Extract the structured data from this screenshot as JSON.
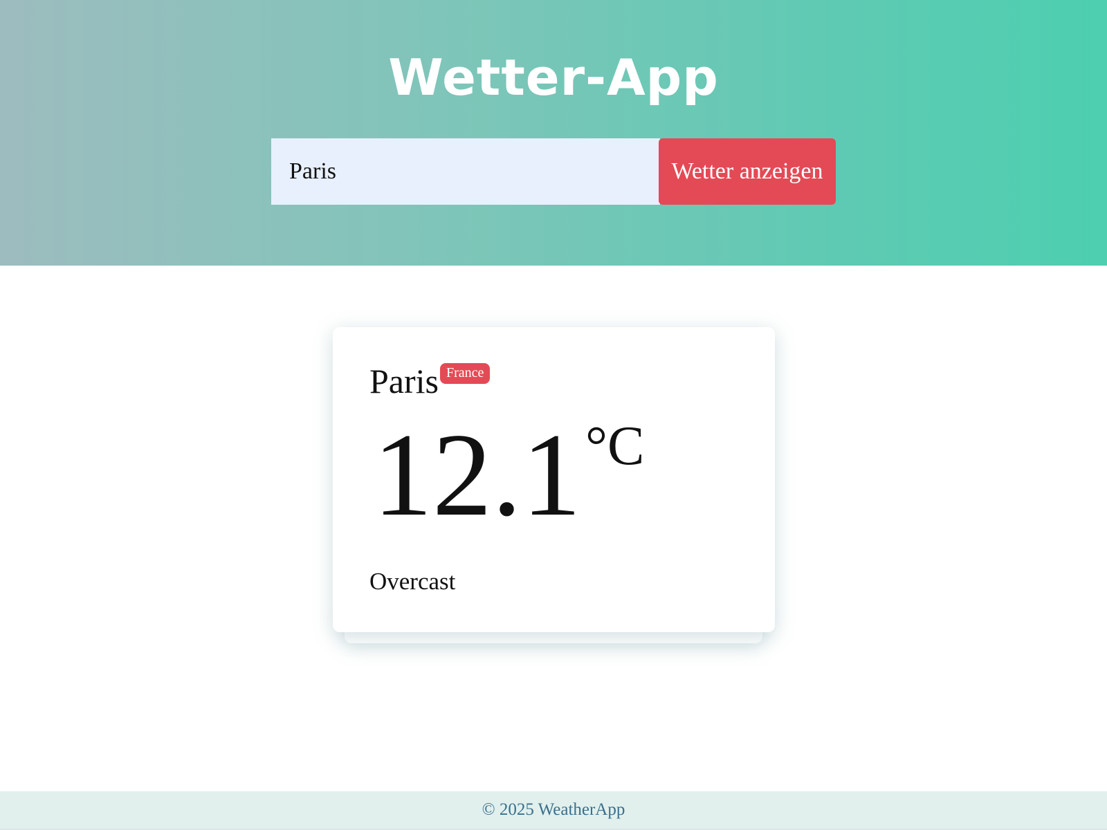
{
  "header": {
    "title": "Wetter-App",
    "search": {
      "value": "Paris",
      "placeholder": ""
    },
    "search_button_label": "Wetter anzeigen"
  },
  "weather_card": {
    "city": "Paris",
    "country": "France",
    "temperature": "12.1",
    "unit": "°C",
    "condition": "Overcast"
  },
  "footer": {
    "text": "© 2025 WeatherApp"
  },
  "colors": {
    "accent": "#e44a55",
    "header_gradient_start": "#9dbcbf",
    "header_gradient_end": "#4dcfb0",
    "input_background": "#e8f0fe",
    "footer_background": "#e2f0ed",
    "footer_text": "#3a6f8c"
  }
}
